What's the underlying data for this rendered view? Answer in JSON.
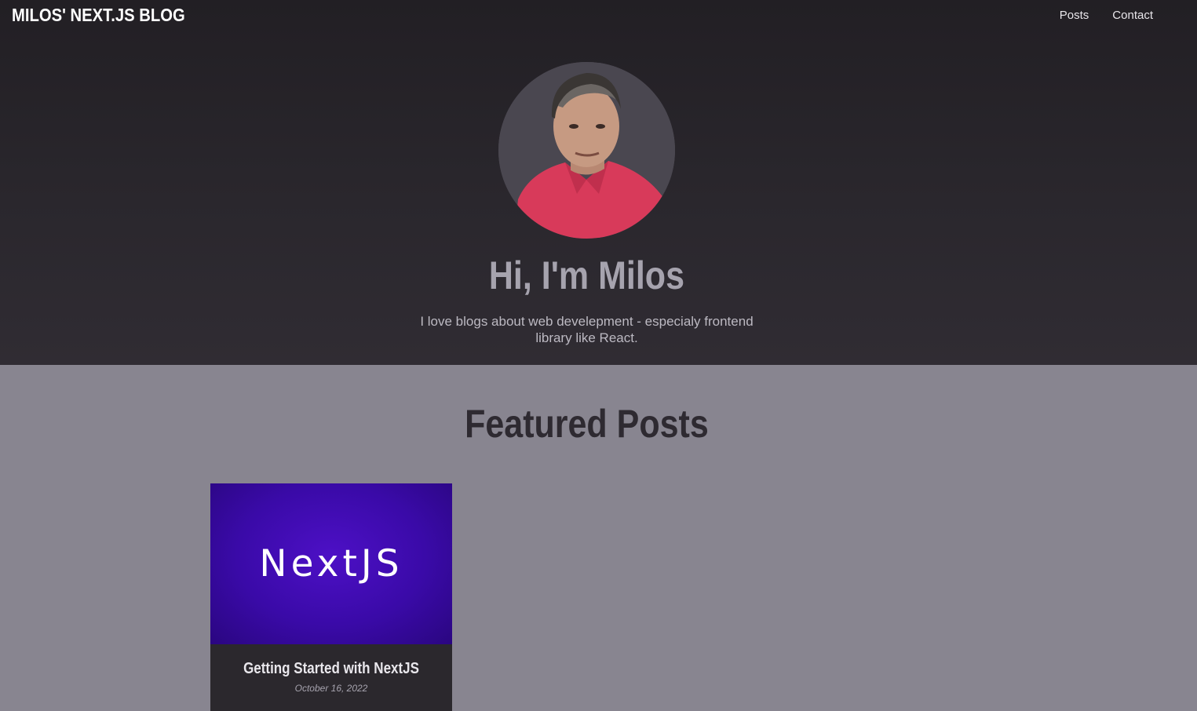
{
  "header": {
    "logo": "MILOS' NEXT.JS BLOG",
    "nav": [
      {
        "label": "Posts"
      },
      {
        "label": "Contact"
      }
    ]
  },
  "hero": {
    "title": "Hi, I'm Milos",
    "text": "I love blogs about web develepment - especialy frontend library like React."
  },
  "featured": {
    "title": "Featured Posts",
    "posts": [
      {
        "image_text": "NextJS",
        "title": "Getting Started with NextJS",
        "date": "October 16, 2022"
      }
    ]
  },
  "colors": {
    "header_bg": "#221f24",
    "page_bg": "#888590",
    "card_bg": "#2b282d",
    "card_image_bg": "#4d10c6"
  }
}
